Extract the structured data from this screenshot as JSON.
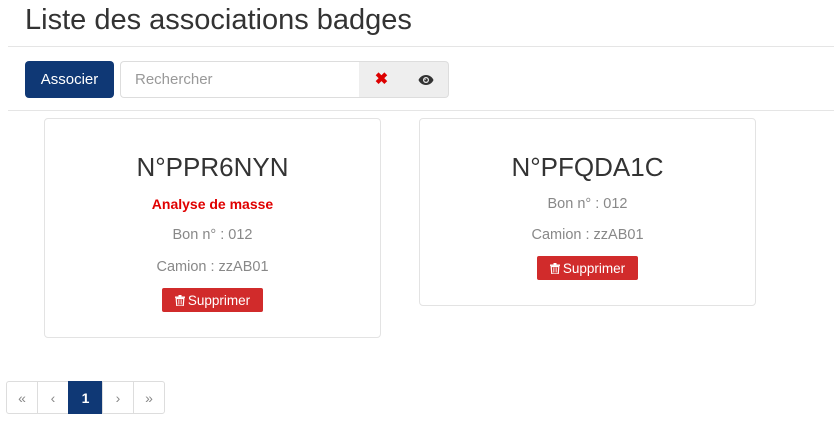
{
  "page": {
    "title": "Liste des associations badges"
  },
  "toolbar": {
    "associer_label": "Associer",
    "search_placeholder": "Rechercher",
    "clear_symbol": "✖"
  },
  "cards": [
    {
      "badge": "N°PPR6NYN",
      "flag": "Analyse de masse",
      "bon": "Bon n° : 012",
      "camion": "Camion : zzAB01",
      "delete_label": "Supprimer"
    },
    {
      "badge": "N°PFQDA1C",
      "bon": "Bon n° : 012",
      "camion": "Camion : zzAB01",
      "delete_label": "Supprimer"
    }
  ],
  "pagination": {
    "first": "«",
    "prev": "‹",
    "current": "1",
    "next": "›",
    "last": "»"
  },
  "colors": {
    "primary": "#0f3875",
    "danger": "#d12b2b",
    "flag": "#e00000"
  }
}
